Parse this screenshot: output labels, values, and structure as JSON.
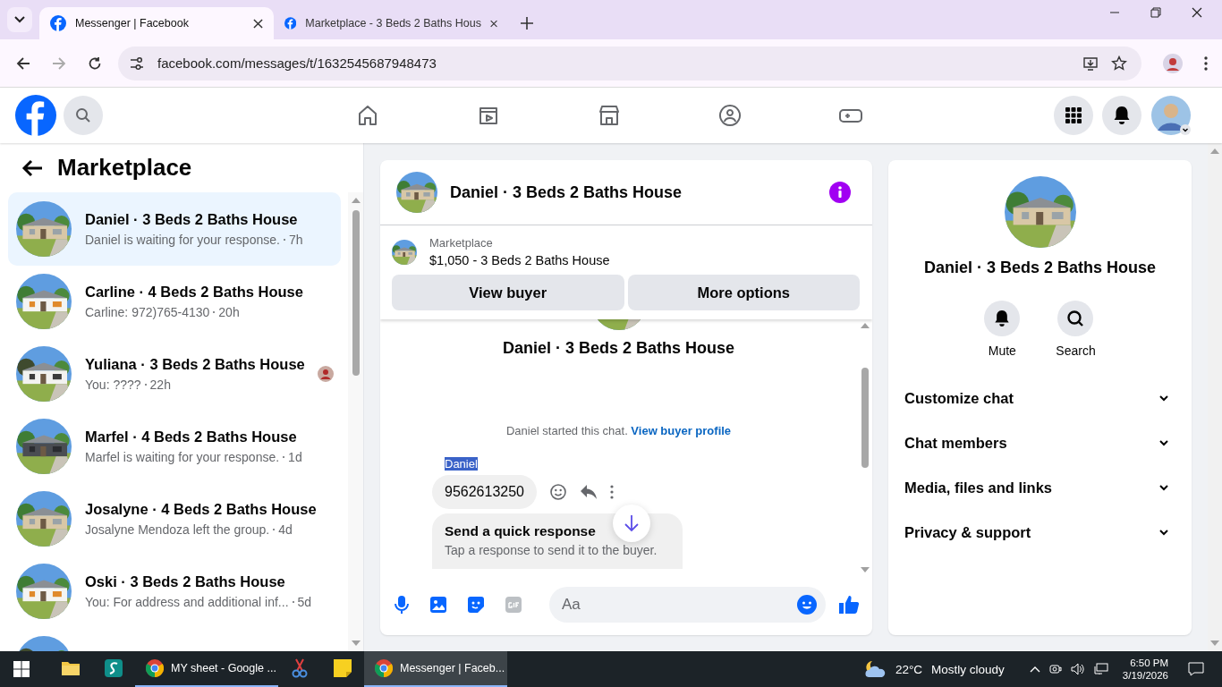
{
  "browser": {
    "tabs": [
      {
        "title": "Messenger | Facebook",
        "selected": true
      },
      {
        "title": "Marketplace - 3 Beds 2 Baths Hous",
        "selected": false
      }
    ],
    "url": "facebook.com/messages/t/1632545687948473"
  },
  "nav": {
    "items": [
      {
        "kind": "home"
      },
      {
        "kind": "video"
      },
      {
        "kind": "store"
      },
      {
        "kind": "groups"
      },
      {
        "kind": "gaming"
      }
    ]
  },
  "sidebar": {
    "title": "Marketplace",
    "conversations": [
      {
        "name": "Daniel · 3 Beds 2 Baths House",
        "preview": "Daniel is waiting for your response.",
        "time": "7h",
        "selected": true,
        "read_receipt": false
      },
      {
        "name": "Carline · 4 Beds 2 Baths House",
        "preview": "Carline: 972)765-4130",
        "time": "20h",
        "selected": false,
        "read_receipt": false
      },
      {
        "name": "Yuliana · 3 Beds 2 Baths House",
        "preview": "You: ????",
        "time": "22h",
        "selected": false,
        "read_receipt": true
      },
      {
        "name": "Marfel · 4 Beds 2 Baths House",
        "preview": "Marfel is waiting for your response.",
        "time": "1d",
        "selected": false,
        "read_receipt": false
      },
      {
        "name": "Josalyne · 4 Beds 2 Baths House",
        "preview": "Josalyne Mendoza left the group.",
        "time": "4d",
        "selected": false,
        "read_receipt": false
      },
      {
        "name": "Oski · 3 Beds 2 Baths House",
        "preview": "You: For address and additional inf...",
        "time": "5d",
        "selected": false,
        "read_receipt": false
      }
    ]
  },
  "chat": {
    "title": "Daniel · 3 Beds 2 Baths House",
    "listing": {
      "label": "Marketplace",
      "title": "$1,050 - 3 Beds 2 Baths House"
    },
    "buttons": [
      "View buyer",
      "More options"
    ],
    "intro_title": "Daniel · 3 Beds 2 Baths House",
    "started": "Daniel started this chat.",
    "profile_link": "View buyer profile",
    "sender": {
      "name": "Daniel",
      "highlighted": true
    },
    "message": "9562613250",
    "quick_response": {
      "title": "Send a quick response",
      "subtitle": "Tap a response to send it to the buyer."
    },
    "composer": {
      "placeholder": "Aa"
    }
  },
  "info": {
    "title": "Daniel · 3 Beds 2 Baths House",
    "actions": [
      {
        "kind": "bell",
        "label": "Mute"
      },
      {
        "kind": "search",
        "label": "Search"
      }
    ],
    "sections": [
      "Customize chat",
      "Chat members",
      "Media, files and links",
      "Privacy & support"
    ]
  },
  "taskbar": {
    "apps": [
      {
        "kind": "folder",
        "active": false
      },
      {
        "kind": "s",
        "active": false
      },
      {
        "kind": "chrome",
        "label": "MY sheet - Google ...",
        "active": false
      },
      {
        "kind": "snip",
        "active": false
      },
      {
        "kind": "note",
        "active": false
      },
      {
        "kind": "chrome",
        "label": "Messenger | Faceb...",
        "active": true
      }
    ],
    "temperature": "22°C",
    "weather": "Mostly cloudy",
    "time": "6:50 PM",
    "date": "3/19/2026"
  }
}
